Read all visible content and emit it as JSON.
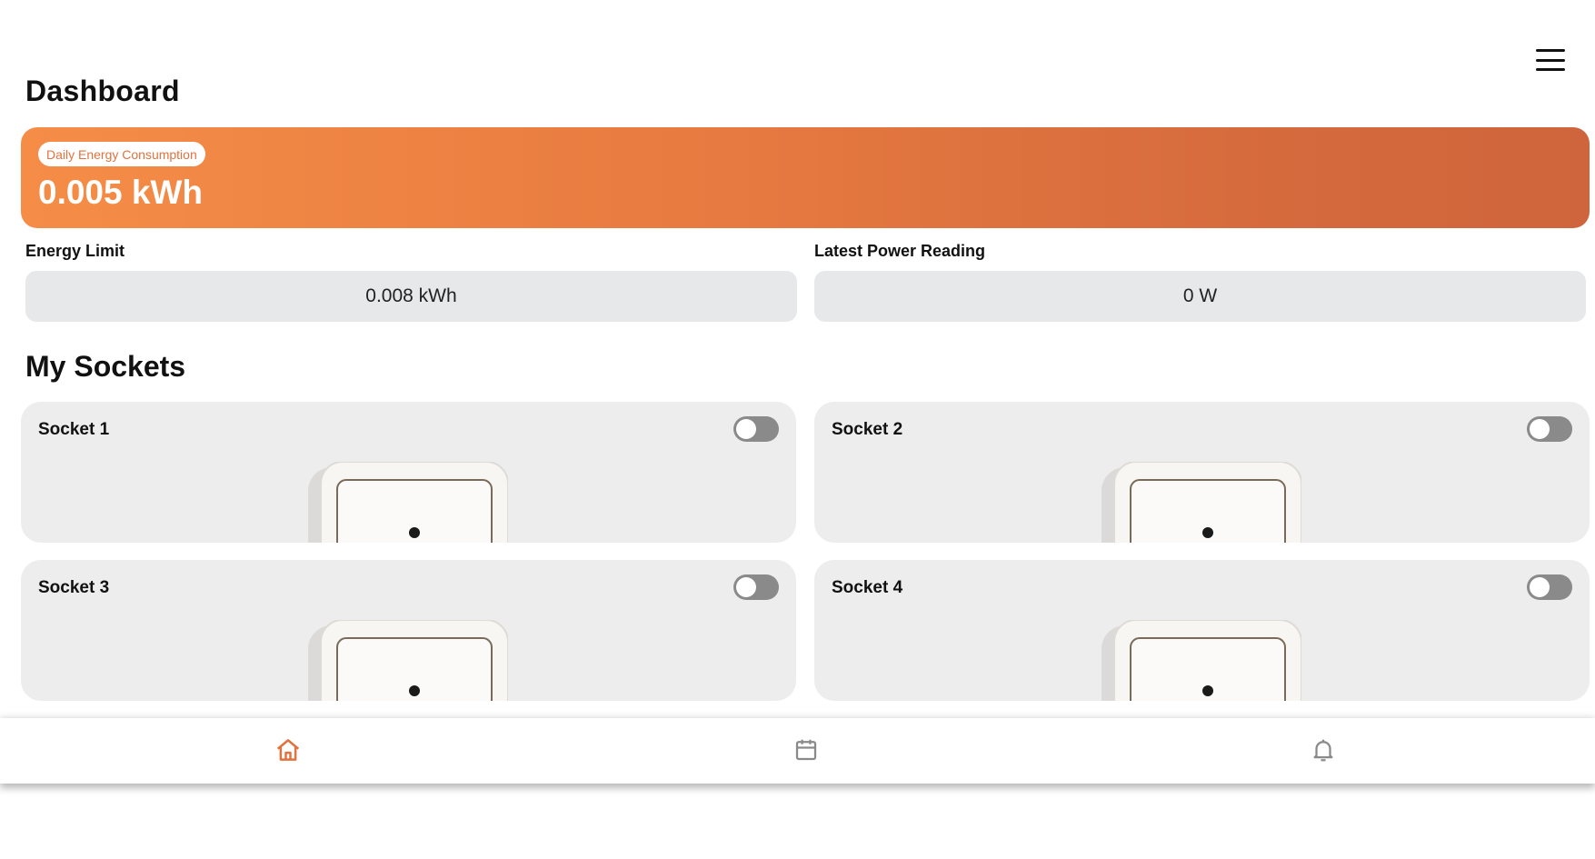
{
  "header": {
    "title": "Dashboard"
  },
  "energy": {
    "label": "Daily Energy Consumption",
    "value": "0.005 kWh"
  },
  "limit": {
    "label": "Energy Limit",
    "value": "0.008 kWh"
  },
  "power": {
    "label": "Latest Power Reading",
    "value": "0 W"
  },
  "sockets": {
    "title": "My Sockets",
    "items": [
      {
        "name": "Socket 1",
        "on": false
      },
      {
        "name": "Socket 2",
        "on": false
      },
      {
        "name": "Socket 3",
        "on": false
      },
      {
        "name": "Socket 4",
        "on": false
      }
    ]
  },
  "nav": {
    "items": [
      {
        "icon": "home-icon",
        "active": true
      },
      {
        "icon": "calendar-icon",
        "active": false
      },
      {
        "icon": "bell-icon",
        "active": false
      }
    ]
  },
  "colors": {
    "accent": "#e0733f",
    "banner_start": "#f58d47",
    "banner_end": "#cf653c",
    "inactive_icon": "#8a8a8a"
  }
}
